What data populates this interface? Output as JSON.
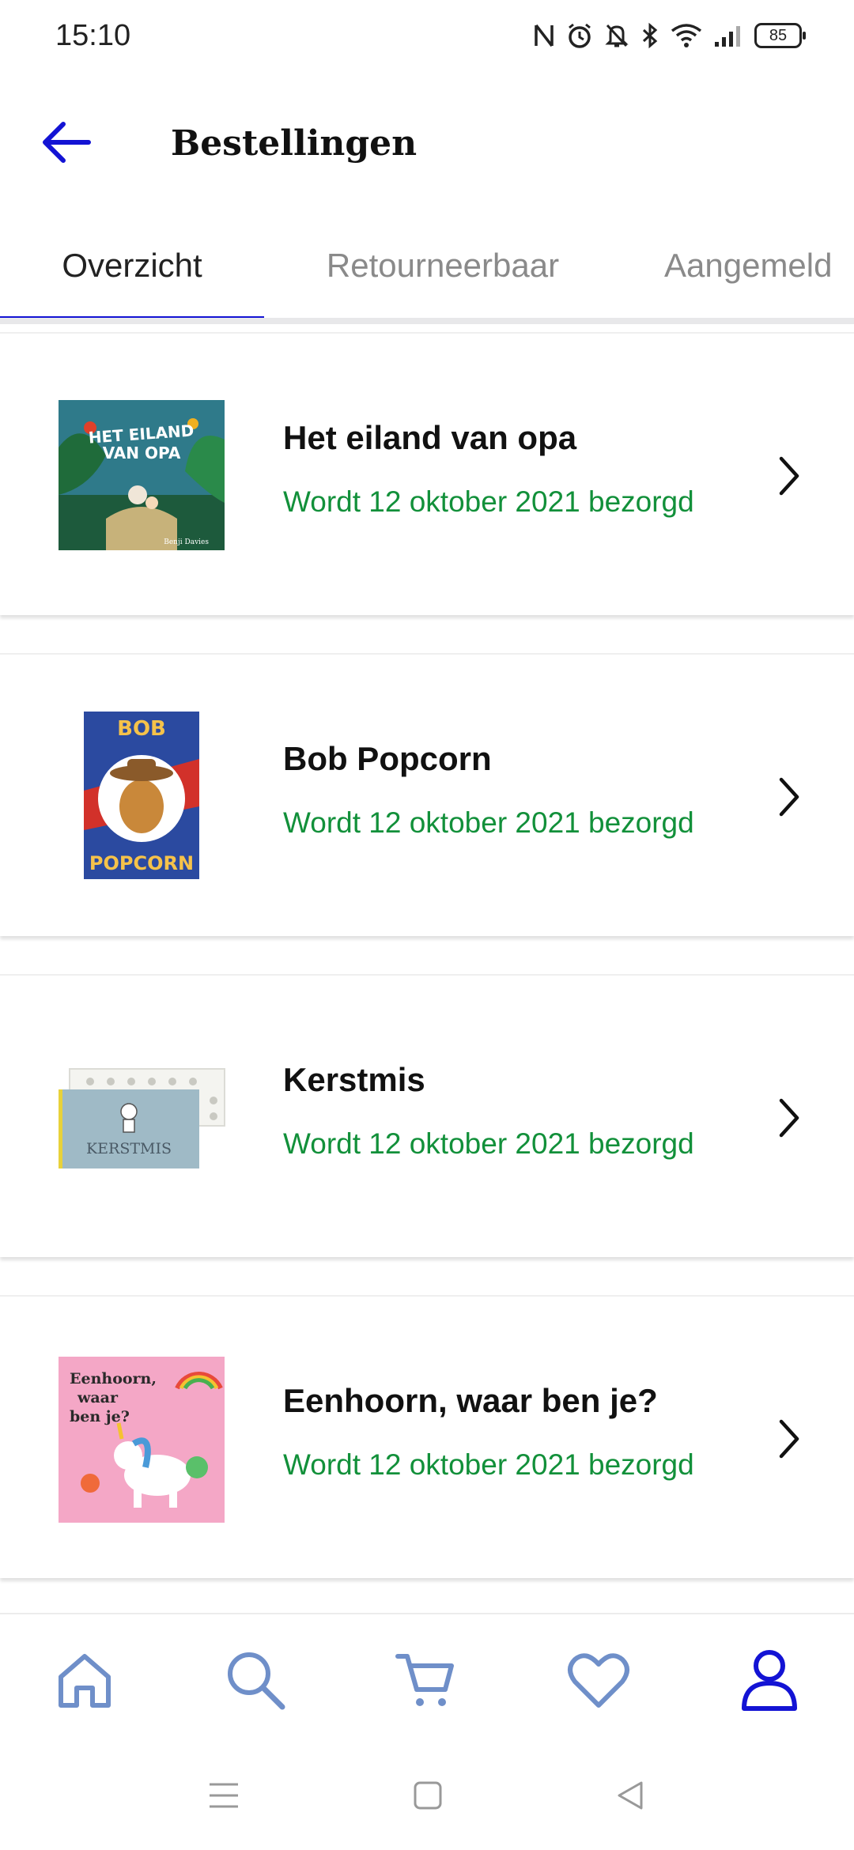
{
  "status_bar": {
    "time": "15:10",
    "battery": "85",
    "icons": [
      "nfc-icon",
      "alarm-icon",
      "bell-off-icon",
      "bluetooth-icon",
      "wifi-icon",
      "signal-icon",
      "battery-icon"
    ]
  },
  "header": {
    "title": "Bestellingen",
    "back_icon": "arrow-left-icon"
  },
  "tabs": [
    {
      "label": "Overzicht",
      "active": true
    },
    {
      "label": "Retourneerbaar",
      "active": false
    },
    {
      "label": "Aangemeld",
      "active": false
    }
  ],
  "orders": [
    {
      "title": "Het eiland van opa",
      "status": "Wordt 12 oktober 2021 bezorgd",
      "cover_text": [
        "HET EILAND",
        "VAN OPA"
      ],
      "cover_author": "Benji Davies"
    },
    {
      "title": "Bob Popcorn",
      "status": "Wordt 12 oktober 2021 bezorgd",
      "cover_text": [
        "BOB",
        "POPCORN"
      ]
    },
    {
      "title": "Kerstmis",
      "status": "Wordt 12 oktober 2021 bezorgd",
      "cover_text": [
        "KERSTMIS"
      ]
    },
    {
      "title": "Eenhoorn, waar ben je?",
      "status": "Wordt 12 oktober 2021 bezorgd",
      "cover_text": [
        "Eenhoorn,",
        "waar",
        "ben je?"
      ]
    }
  ],
  "bottom_nav": [
    {
      "icon": "home-icon",
      "active": false
    },
    {
      "icon": "search-icon",
      "active": false
    },
    {
      "icon": "cart-icon",
      "active": false
    },
    {
      "icon": "heart-icon",
      "active": false
    },
    {
      "icon": "account-icon",
      "active": true
    }
  ],
  "colors": {
    "accent": "#1313d4",
    "status_green": "#12903a",
    "nav_inactive": "#6f8fc9"
  }
}
